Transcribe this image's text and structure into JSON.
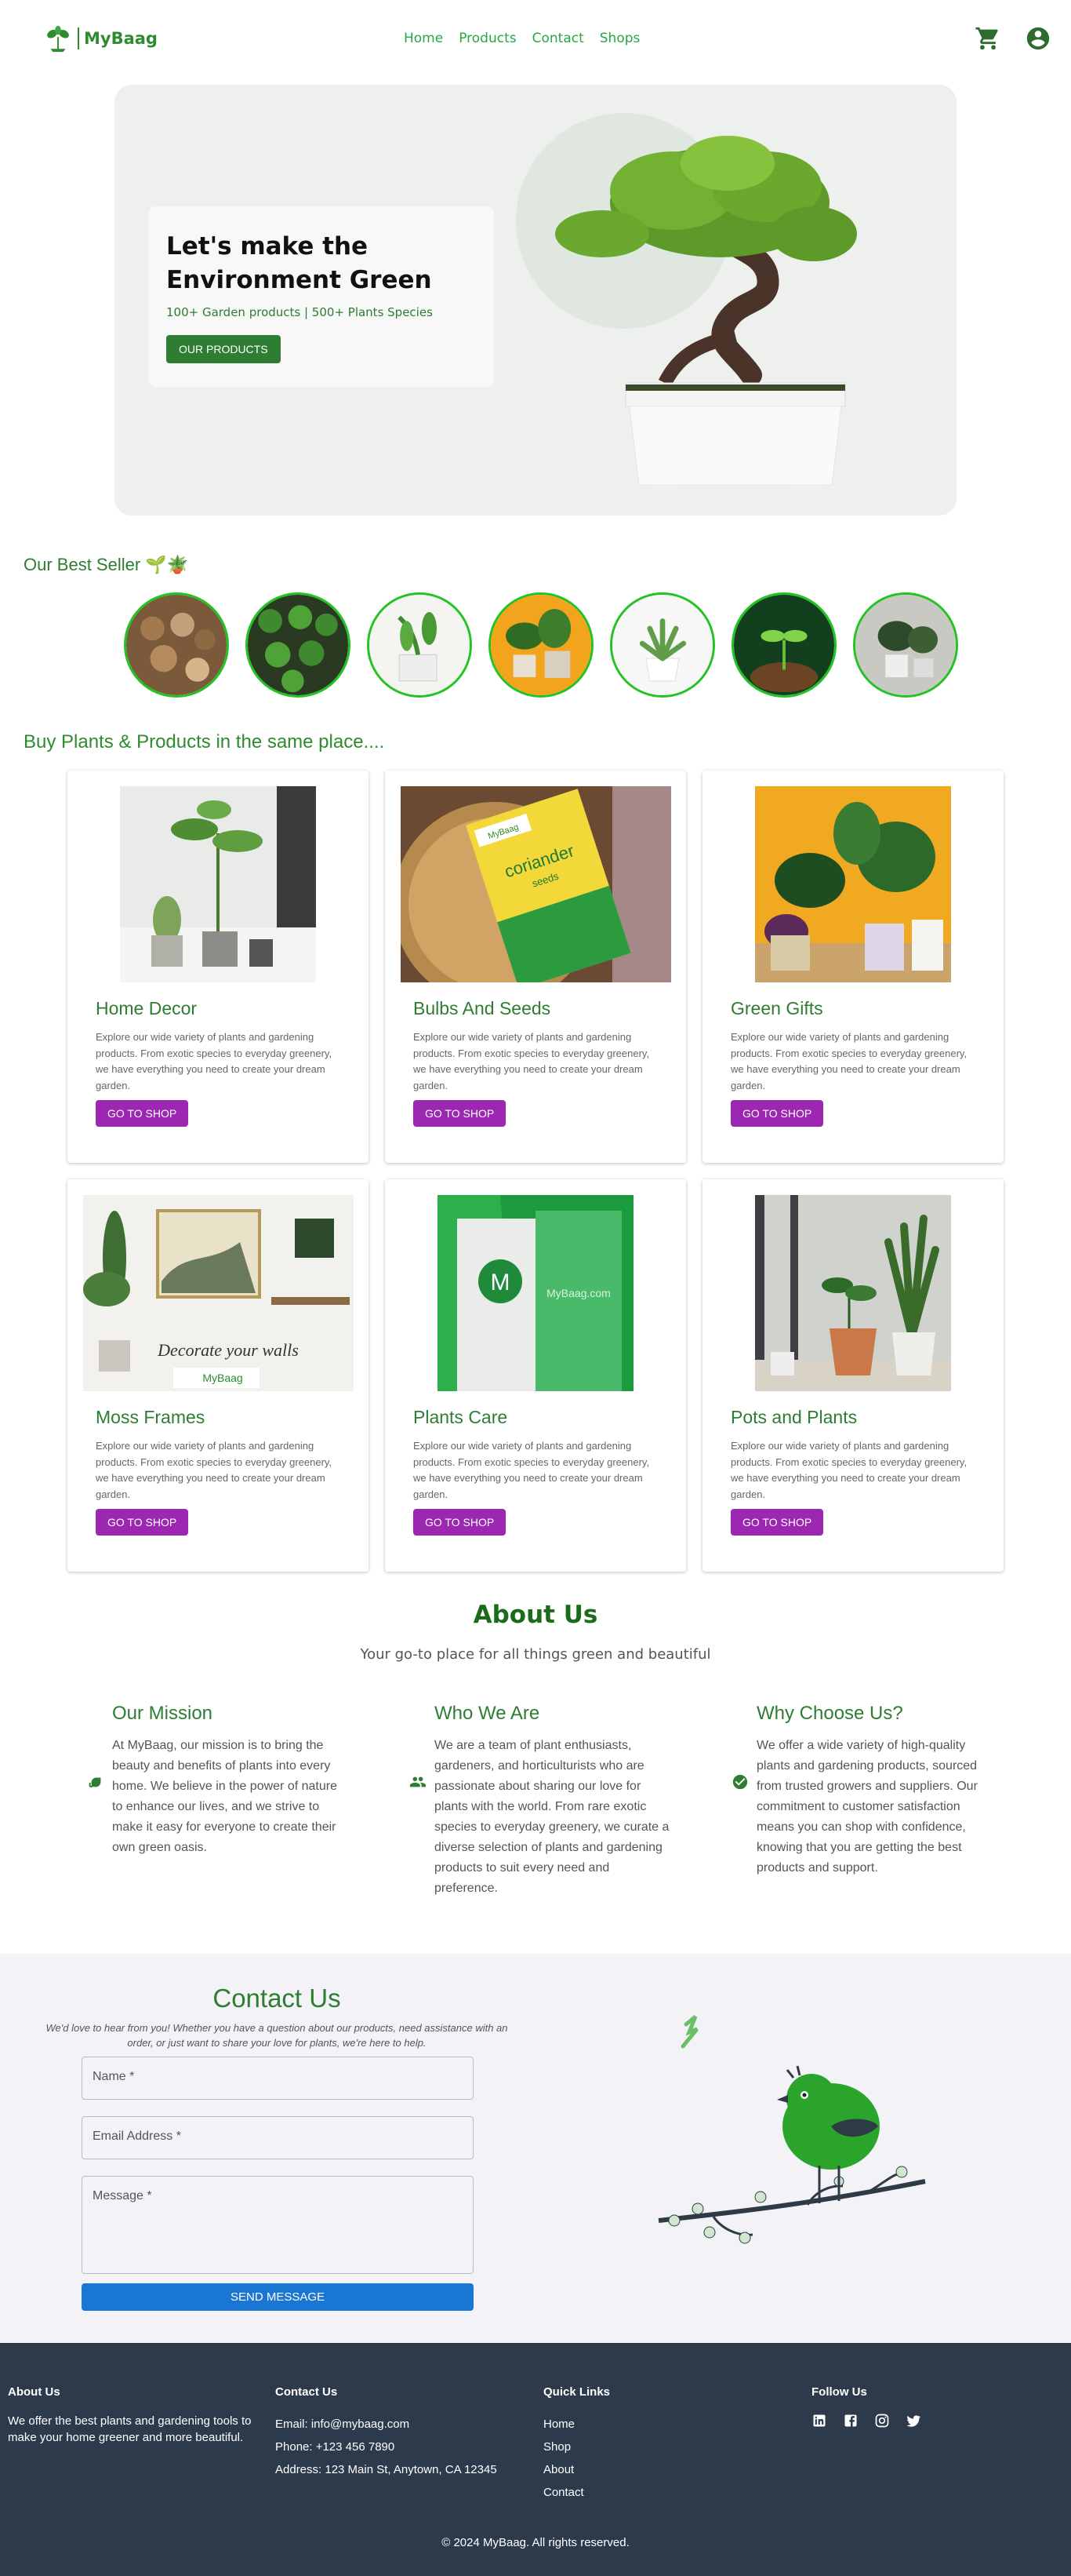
{
  "nav": {
    "brand": "MyBaag",
    "links": [
      "Home",
      "Products",
      "Contact",
      "Shops"
    ],
    "icons": [
      "cart-icon",
      "account-icon"
    ]
  },
  "hero": {
    "title_line1": "Let's make the",
    "title_line2": "Environment Green",
    "subtitle": "100+ Garden products | 500+ Plants Species",
    "button": "OUR PRODUCTS"
  },
  "best_seller": {
    "title": "Our Best Seller 🌱🪴"
  },
  "products": {
    "title": "Buy Plants & Products in the same place....",
    "description": "Explore our wide variety of plants and gardening products. From exotic species to everyday greenery, we have everything you need to create your dream garden.",
    "button": "GO TO SHOP",
    "items": [
      {
        "name": "Home Decor"
      },
      {
        "name": "Bulbs And Seeds",
        "pack_text": "coriander",
        "pack_sub": "seeds",
        "brand": "MyBaag"
      },
      {
        "name": "Green Gifts"
      },
      {
        "name": "Moss Frames",
        "caption": "Decorate your walls",
        "brand": "MyBaag"
      },
      {
        "name": "Plants Care",
        "badge": "M",
        "brand": "MyBaag.com"
      },
      {
        "name": "Pots and Plants"
      }
    ]
  },
  "about": {
    "title": "About Us",
    "tagline": "Your go-to place for all things green and beautiful",
    "columns": [
      {
        "title": "Our Mission",
        "text": "At MyBaag, our mission is to bring the beauty and benefits of plants into every home. We believe in the power of nature to enhance our lives, and we strive to make it easy for everyone to create their own green oasis."
      },
      {
        "title": "Who We Are",
        "text": "We are a team of plant enthusiasts, gardeners, and horticulturists who are passionate about sharing our love for plants with the world. From rare exotic species to everyday greenery, we curate a diverse selection of plants and gardening products to suit every need and preference."
      },
      {
        "title": "Why Choose Us?",
        "text": "We offer a wide variety of high-quality plants and gardening products, sourced from trusted growers and suppliers. Our commitment to customer satisfaction means you can shop with confidence, knowing that you are getting the best products and support."
      }
    ]
  },
  "contact": {
    "title": "Contact Us",
    "description": "We'd love to hear from you! Whether you have a question about our products, need assistance with an order, or just want to share your love for plants, we're here to help.",
    "name_placeholder": "Name *",
    "email_placeholder": "Email Address *",
    "message_placeholder": "Message *",
    "send": "SEND MESSAGE"
  },
  "footer": {
    "about_title": "About Us",
    "about_text": "We offer the best plants and gardening tools to make your home greener and more beautiful.",
    "contact_title": "Contact Us",
    "email": "Email: info@mybaag.com",
    "phone": "Phone: +123 456 7890",
    "address": "Address: 123 Main St, Anytown, CA 12345",
    "links_title": "Quick Links",
    "links": [
      "Home",
      "Shop",
      "About",
      "Contact"
    ],
    "follow_title": "Follow Us",
    "social": [
      "linkedin-icon",
      "facebook-icon",
      "instagram-icon",
      "twitter-icon"
    ],
    "copyright": "© 2024 MyBaag. All rights reserved."
  },
  "colors": {
    "accent": "#2e7d32",
    "link": "#28a745",
    "button_purple": "#9c27b0",
    "button_blue": "#1976d2",
    "footer_bg": "#2c3a4c"
  }
}
